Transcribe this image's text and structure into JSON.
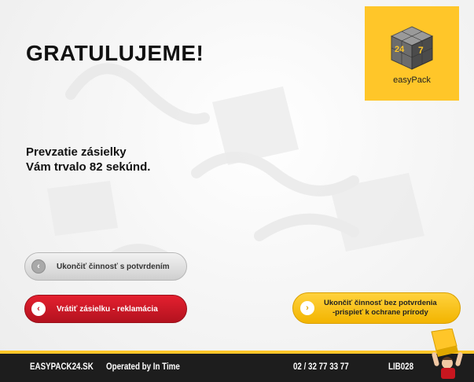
{
  "header": {
    "title": "GRATULUJEME!"
  },
  "logo": {
    "text": "easyPack",
    "icon": "cube-24-7-logo"
  },
  "message": {
    "line1": "Prevzatie zásielky",
    "line2": "Vám trvalo 82 sekúnd."
  },
  "buttons": {
    "finish_confirm": {
      "label": "Ukončiť činnosť s potvrdením",
      "icon": "chevron-left-icon"
    },
    "return_complaint": {
      "label": "Vrátiť zásielku - reklamácia",
      "icon": "chevron-left-icon"
    },
    "finish_no_confirm": {
      "line1": "Ukončiť činnosť bez potvrdenia",
      "line2": "-prispieť k ochrane prírody",
      "icon": "chevron-right-icon"
    }
  },
  "footer": {
    "website": "EASYPACK24.SK",
    "operator": "Operated by In Time",
    "phone": "02 / 32 77 33 77",
    "terminal_id": "LIB028"
  },
  "colors": {
    "brand_yellow": "#ffc629",
    "red": "#c8161f",
    "footer_bg": "#1d1d1d"
  }
}
